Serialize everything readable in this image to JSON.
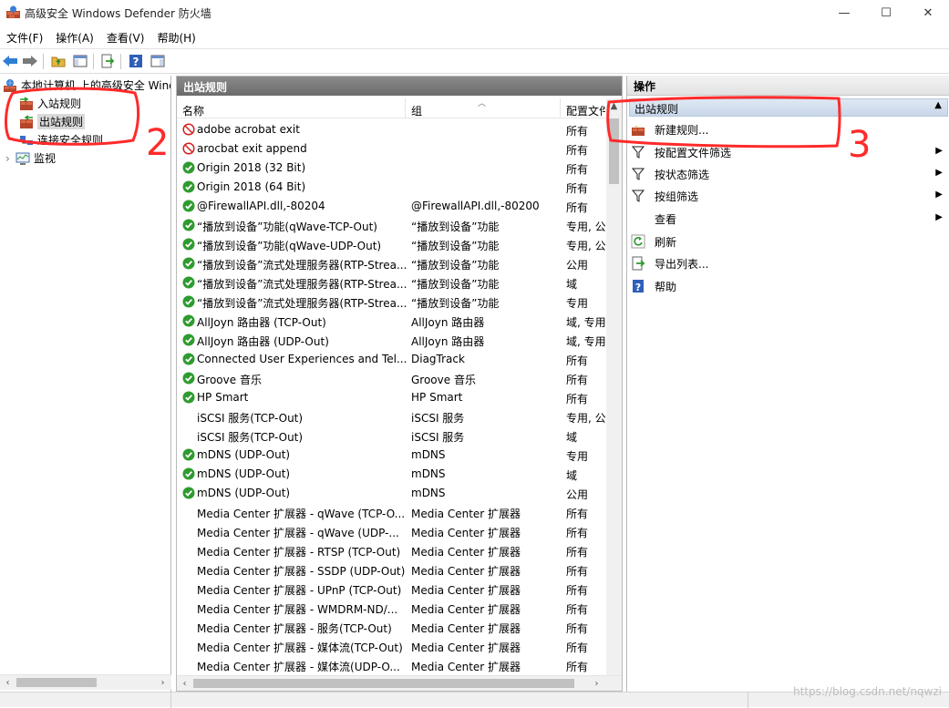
{
  "window": {
    "title": "高级安全 Windows Defender 防火墙",
    "controls": {
      "minimize": "—",
      "maximize": "☐",
      "close": "✕"
    }
  },
  "menu": [
    "文件(F)",
    "操作(A)",
    "查看(V)",
    "帮助(H)"
  ],
  "toolbar": {
    "icons": [
      "back-arrow-icon",
      "forward-arrow-icon",
      "folder-up-icon",
      "show-hide-tree-icon",
      "export-list-icon",
      "help-icon",
      "show-hide-action-pane-icon"
    ]
  },
  "tree": {
    "root": "本地计算机 上的高级安全 Windows Defender 防火墙",
    "items": [
      {
        "label": "入站规则",
        "icon": "inbound-rules-icon"
      },
      {
        "label": "出站规则",
        "icon": "outbound-rules-icon",
        "selected": true
      },
      {
        "label": "连接安全规则",
        "icon": "connection-security-icon"
      },
      {
        "label": "监视",
        "icon": "monitor-icon",
        "expander": "›"
      }
    ]
  },
  "center": {
    "header": "出站规则",
    "columns": [
      "名称",
      "组",
      "配置文件"
    ],
    "rows": [
      {
        "name": "adobe acrobat exit",
        "group": "",
        "profile": "所有",
        "status": "blocked"
      },
      {
        "name": "arocbat exit append",
        "group": "",
        "profile": "所有",
        "status": "blocked"
      },
      {
        "name": "Origin 2018 (32 Bit)",
        "group": "",
        "profile": "所有",
        "status": "allowed"
      },
      {
        "name": "Origin 2018 (64 Bit)",
        "group": "",
        "profile": "所有",
        "status": "allowed"
      },
      {
        "name": "@FirewallAPI.dll,-80204",
        "group": "@FirewallAPI.dll,-80200",
        "profile": "所有",
        "status": "allowed"
      },
      {
        "name": "“播放到设备”功能(qWave-TCP-Out)",
        "group": "“播放到设备”功能",
        "profile": "专用, 公",
        "status": "allowed"
      },
      {
        "name": "“播放到设备”功能(qWave-UDP-Out)",
        "group": "“播放到设备”功能",
        "profile": "专用, 公",
        "status": "allowed"
      },
      {
        "name": "“播放到设备”流式处理服务器(RTP-Strea...",
        "group": "“播放到设备”功能",
        "profile": "公用",
        "status": "allowed"
      },
      {
        "name": "“播放到设备”流式处理服务器(RTP-Strea...",
        "group": "“播放到设备”功能",
        "profile": "域",
        "status": "allowed"
      },
      {
        "name": "“播放到设备”流式处理服务器(RTP-Strea...",
        "group": "“播放到设备”功能",
        "profile": "专用",
        "status": "allowed"
      },
      {
        "name": "AllJoyn 路由器 (TCP-Out)",
        "group": "AllJoyn 路由器",
        "profile": "域, 专用",
        "status": "allowed"
      },
      {
        "name": "AllJoyn 路由器 (UDP-Out)",
        "group": "AllJoyn 路由器",
        "profile": "域, 专用",
        "status": "allowed"
      },
      {
        "name": "Connected User Experiences and Tel...",
        "group": "DiagTrack",
        "profile": "所有",
        "status": "allowed"
      },
      {
        "name": "Groove 音乐",
        "group": "Groove 音乐",
        "profile": "所有",
        "status": "allowed"
      },
      {
        "name": "HP Smart",
        "group": "HP Smart",
        "profile": "所有",
        "status": "allowed"
      },
      {
        "name": "iSCSI 服务(TCP-Out)",
        "group": "iSCSI 服务",
        "profile": "专用, 公",
        "status": "none"
      },
      {
        "name": "iSCSI 服务(TCP-Out)",
        "group": "iSCSI 服务",
        "profile": "域",
        "status": "none"
      },
      {
        "name": "mDNS (UDP-Out)",
        "group": "mDNS",
        "profile": "专用",
        "status": "allowed"
      },
      {
        "name": "mDNS (UDP-Out)",
        "group": "mDNS",
        "profile": "域",
        "status": "allowed"
      },
      {
        "name": "mDNS (UDP-Out)",
        "group": "mDNS",
        "profile": "公用",
        "status": "allowed"
      },
      {
        "name": "Media Center 扩展器 - qWave (TCP-O...",
        "group": "Media Center 扩展器",
        "profile": "所有",
        "status": "none"
      },
      {
        "name": "Media Center 扩展器 - qWave (UDP-...",
        "group": "Media Center 扩展器",
        "profile": "所有",
        "status": "none"
      },
      {
        "name": "Media Center 扩展器 - RTSP (TCP-Out)",
        "group": "Media Center 扩展器",
        "profile": "所有",
        "status": "none"
      },
      {
        "name": "Media Center 扩展器 - SSDP (UDP-Out)",
        "group": "Media Center 扩展器",
        "profile": "所有",
        "status": "none"
      },
      {
        "name": "Media Center 扩展器 - UPnP (TCP-Out)",
        "group": "Media Center 扩展器",
        "profile": "所有",
        "status": "none"
      },
      {
        "name": "Media Center 扩展器 - WMDRM-ND/...",
        "group": "Media Center 扩展器",
        "profile": "所有",
        "status": "none"
      },
      {
        "name": "Media Center 扩展器 - 服务(TCP-Out)",
        "group": "Media Center 扩展器",
        "profile": "所有",
        "status": "none"
      },
      {
        "name": "Media Center 扩展器 - 媒体流(TCP-Out)",
        "group": "Media Center 扩展器",
        "profile": "所有",
        "status": "none"
      },
      {
        "name": "Media Center 扩展器 - 媒体流(UDP-O...",
        "group": "Media Center 扩展器",
        "profile": "所有",
        "status": "none"
      }
    ]
  },
  "actions": {
    "header": "操作",
    "section": "出站规则",
    "items": [
      {
        "label": "新建规则...",
        "icon": "new-rule-icon",
        "submenu": false
      },
      {
        "label": "按配置文件筛选",
        "icon": "filter-icon",
        "submenu": true
      },
      {
        "label": "按状态筛选",
        "icon": "filter-icon",
        "submenu": true
      },
      {
        "label": "按组筛选",
        "icon": "filter-icon",
        "submenu": true
      },
      {
        "label": "查看",
        "icon": "",
        "submenu": true
      },
      {
        "label": "刷新",
        "icon": "refresh-icon",
        "submenu": false
      },
      {
        "label": "导出列表...",
        "icon": "export-list-icon",
        "submenu": false
      },
      {
        "label": "帮助",
        "icon": "help-icon",
        "submenu": false
      }
    ]
  },
  "annotations": [
    "2",
    "3"
  ],
  "watermark": "https://blog.csdn.net/nqwzi",
  "colors": {
    "allowed": "#2e9b2e",
    "blocked": "#d42020",
    "annotation": "#ff2a2a",
    "section": "#c8d7ea"
  }
}
